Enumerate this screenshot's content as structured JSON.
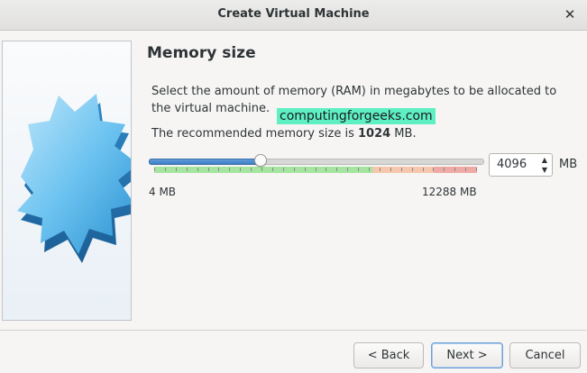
{
  "window": {
    "title": "Create Virtual Machine",
    "close_glyph": "✕"
  },
  "page": {
    "heading": "Memory size",
    "description": "Select the amount of memory (RAM) in megabytes to be allocated to the virtual machine.",
    "watermark": "computingforgeeks.com",
    "recommended_prefix": "The recommended memory size is ",
    "recommended_value": "1024",
    "recommended_suffix": " MB."
  },
  "memory": {
    "value": "4096",
    "unit": "MB",
    "min_label": "4 MB",
    "max_label": "12288 MB",
    "min": 4,
    "max": 12288,
    "current": 4096,
    "spin_up_glyph": "▲",
    "spin_down_glyph": "▼"
  },
  "buttons": {
    "back": "< Back",
    "next": "Next >",
    "cancel": "Cancel"
  },
  "colors": {
    "zone_green": "#a6e5a0",
    "zone_orange": "#f6c6ad",
    "zone_red": "#efaaa6",
    "slider_fill": "#4a8bcf"
  },
  "icons": {
    "banner": "starburst-graphic",
    "close": "close-icon"
  }
}
